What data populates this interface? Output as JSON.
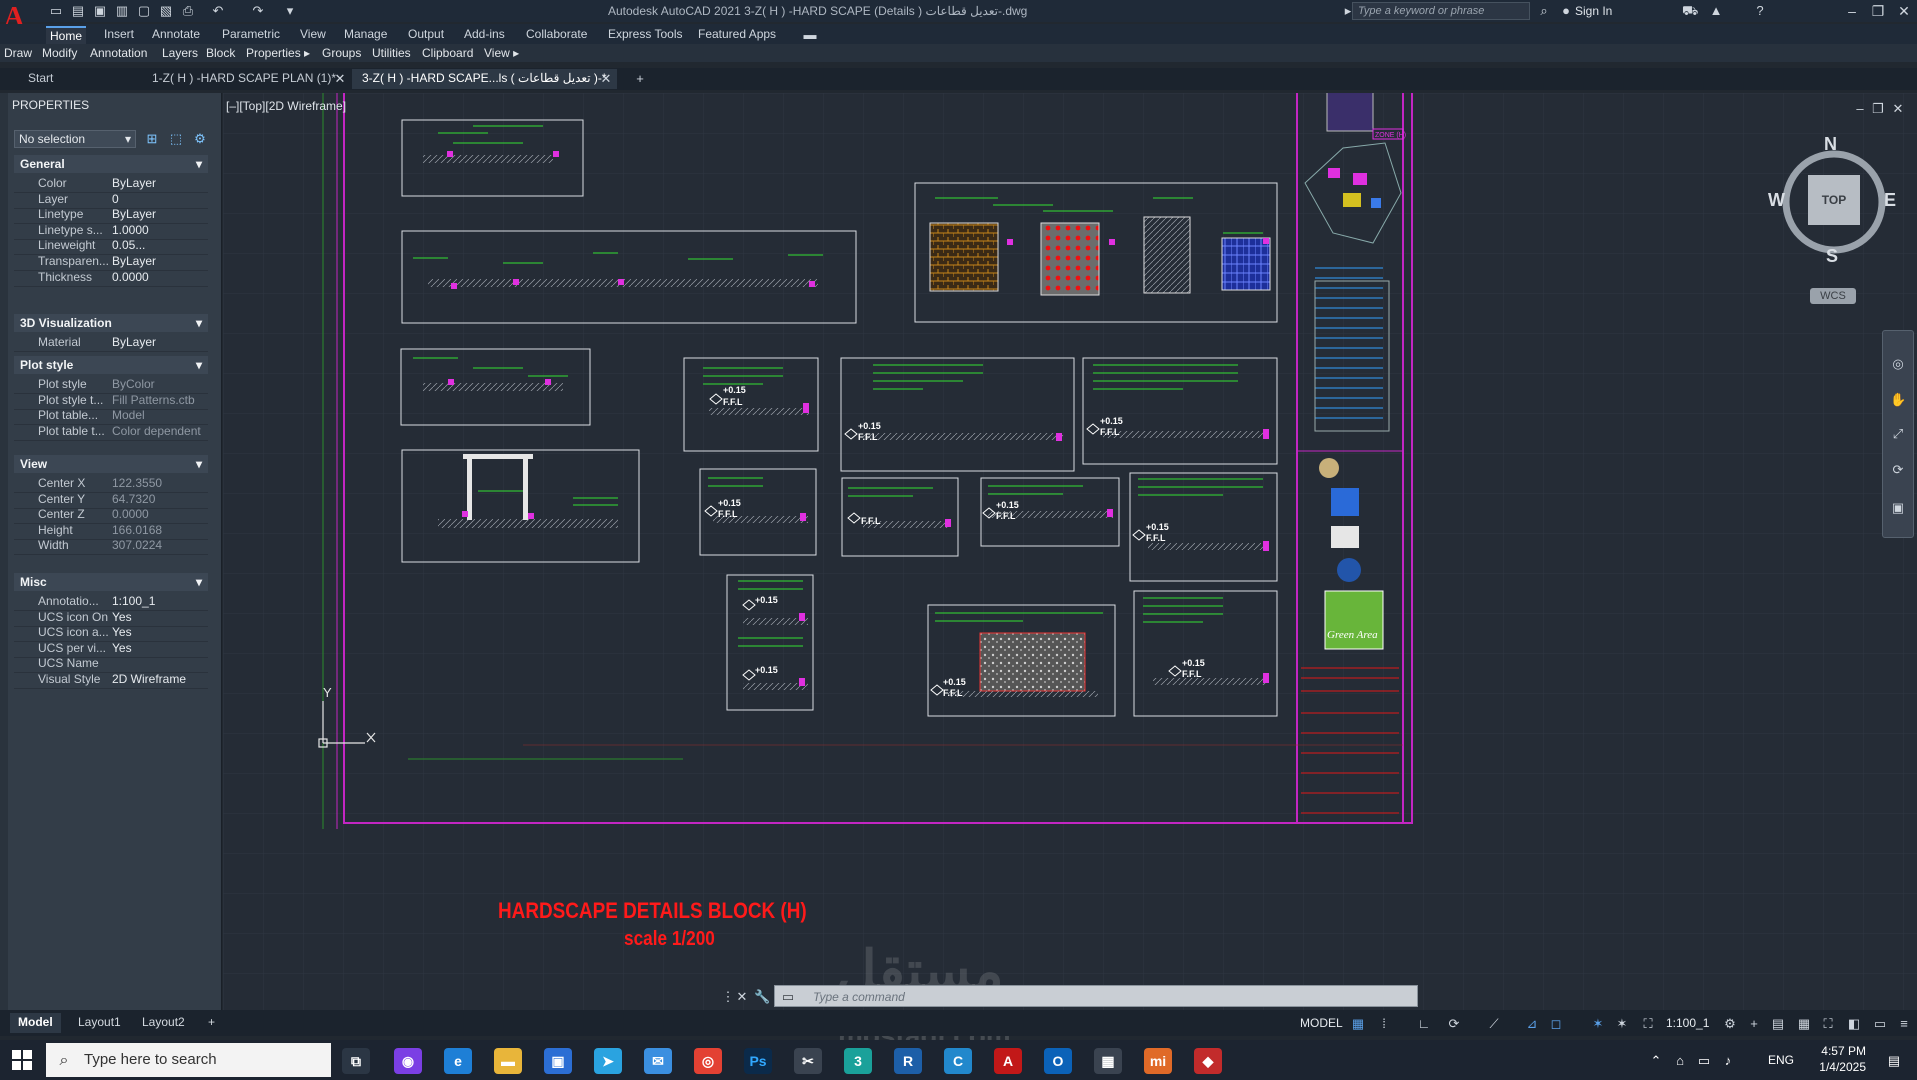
{
  "app": {
    "title": "Autodesk AutoCAD 2021    3-Z( H ) -HARD SCAPE  (Details ) تعديل قطاعات-.dwg",
    "search_placeholder": "Type a keyword or phrase",
    "sign_in": "Sign In"
  },
  "ribbon": {
    "tabs": [
      "Home",
      "Insert",
      "Annotate",
      "Parametric",
      "View",
      "Manage",
      "Output",
      "Add-ins",
      "Collaborate",
      "Express Tools",
      "Featured Apps"
    ],
    "panels": [
      "Draw",
      "Modify",
      "Annotation",
      "Layers",
      "Block",
      "Properties ▸",
      "Groups",
      "Utilities",
      "Clipboard",
      "View ▸"
    ]
  },
  "file_tabs": [
    "Start",
    "1-Z( H ) -HARD SCAPE PLAN (1)*",
    "3-Z( H ) -HARD SCAPE...ls ( تعديل قطاعات )-*"
  ],
  "properties": {
    "title": "PROPERTIES",
    "selection": "No selection",
    "sections": {
      "general": "General",
      "visualization": "3D Visualization",
      "plot_style": "Plot style",
      "view": "View",
      "misc": "Misc"
    },
    "general_rows": [
      {
        "k": "Color",
        "v": "ByLayer"
      },
      {
        "k": "Layer",
        "v": "0"
      },
      {
        "k": "Linetype",
        "v": "ByLayer"
      },
      {
        "k": "Linetype s...",
        "v": "1.0000"
      },
      {
        "k": "Lineweight",
        "v": "0.05..."
      },
      {
        "k": "Transparen...",
        "v": "ByLayer"
      },
      {
        "k": "Thickness",
        "v": "0.0000"
      }
    ],
    "visualization_rows": [
      {
        "k": "Material",
        "v": "ByLayer"
      }
    ],
    "plot_rows": [
      {
        "k": "Plot style",
        "v": "ByColor"
      },
      {
        "k": "Plot style t...",
        "v": "Fill Patterns.ctb"
      },
      {
        "k": "Plot table...",
        "v": "Model"
      },
      {
        "k": "Plot table t...",
        "v": "Color dependent"
      }
    ],
    "view_rows": [
      {
        "k": "Center X",
        "v": "122.3550"
      },
      {
        "k": "Center Y",
        "v": "64.7320"
      },
      {
        "k": "Center Z",
        "v": "0.0000"
      },
      {
        "k": "Height",
        "v": "166.0168"
      },
      {
        "k": "Width",
        "v": "307.0224"
      }
    ],
    "misc_rows": [
      {
        "k": "Annotatio...",
        "v": "1:100_1"
      },
      {
        "k": "UCS icon On",
        "v": "Yes"
      },
      {
        "k": "UCS icon a...",
        "v": "Yes"
      },
      {
        "k": "UCS per vi...",
        "v": "Yes"
      },
      {
        "k": "UCS Name",
        "v": ""
      },
      {
        "k": "Visual Style",
        "v": "2D Wireframe"
      }
    ]
  },
  "viewport": {
    "label": "[–][Top][2D Wireframe]",
    "drawing_title": "HARDSCAPE  DETAILS BLOCK (H)",
    "drawing_scale": "scale 1/200",
    "compass": {
      "n": "N",
      "s": "S",
      "e": "E",
      "w": "W",
      "top": "TOP",
      "wcs": "WCS"
    },
    "ucs": {
      "x": "X",
      "y": "Y"
    },
    "tag_zone": "ZONE (H)",
    "sheet_brand": "Green Area",
    "ffl_label": "F.F.L",
    "level_label": "+0.15"
  },
  "command": {
    "placeholder": "Type  a  command"
  },
  "layout_tabs": [
    "Model",
    "Layout1",
    "Layout2",
    "+"
  ],
  "status": {
    "model": "MODEL",
    "scale": "1:100_1"
  },
  "watermark": {
    "text": "مستقل",
    "sub": "mostaql.com"
  },
  "taskbar": {
    "search": "Type here to search",
    "lang": "ENG",
    "time": "4:57 PM",
    "date": "1/4/2025"
  },
  "colors": {
    "canvas": "#252c36",
    "panel": "#333d48",
    "accent": "#5aa0e8",
    "frame_magenta": "#c326c3",
    "annot_green": "#33e033",
    "title_red": "#ff1a1a"
  }
}
